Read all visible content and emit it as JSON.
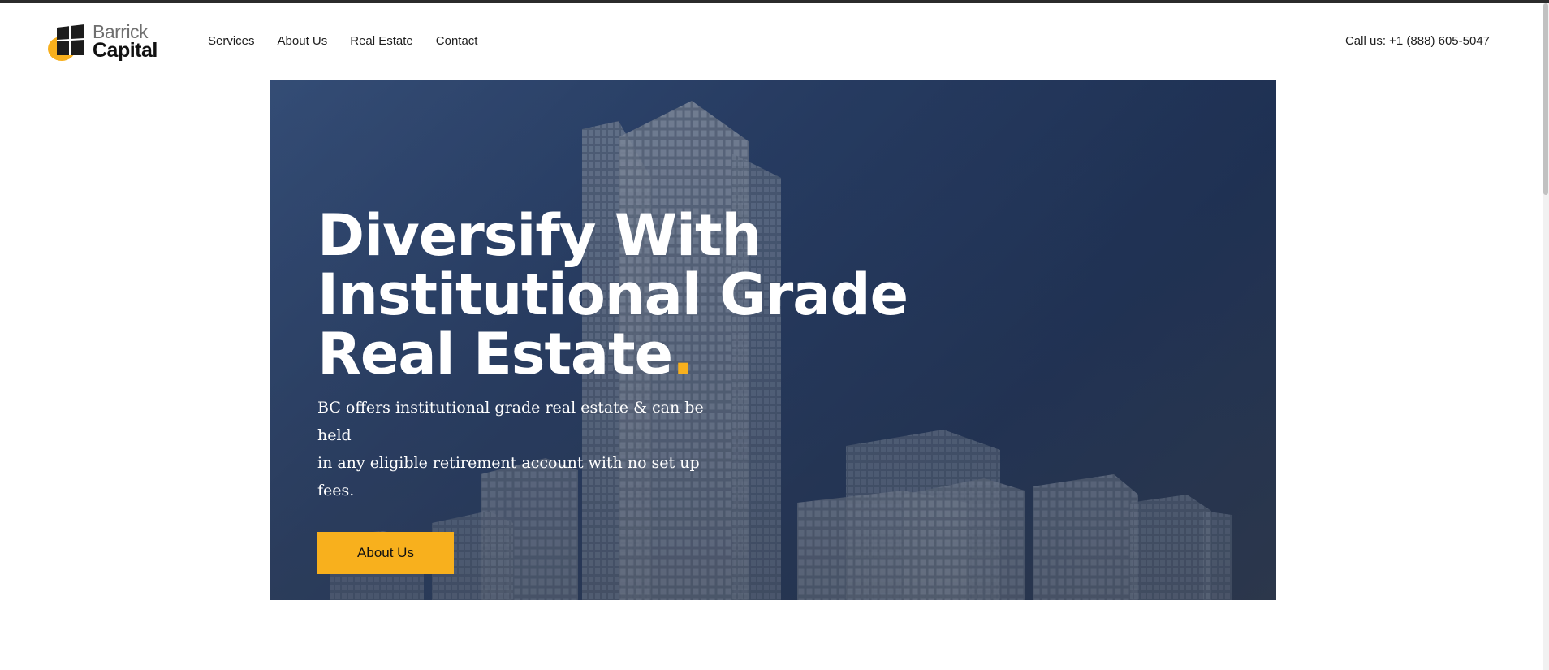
{
  "brand": {
    "name_line1": "Barrick",
    "name_line2": "Capital",
    "accent_color": "#f8b01d"
  },
  "nav": {
    "items": [
      {
        "label": "Services"
      },
      {
        "label": "About Us"
      },
      {
        "label": "Real Estate"
      },
      {
        "label": "Contact"
      }
    ]
  },
  "header": {
    "phone_text": "Call us: +1 (888) 605-5047"
  },
  "hero": {
    "title_line1": "Diversify With",
    "title_line2": "Institutional Grade",
    "title_line3": "Real Estate",
    "title_dot": ".",
    "description_line1": "BC offers institutional grade real estate & can be held",
    "description_line2": "in any eligible retirement account with no set up fees.",
    "cta_label": "About Us",
    "background_image": "skyscraper-buildings"
  }
}
